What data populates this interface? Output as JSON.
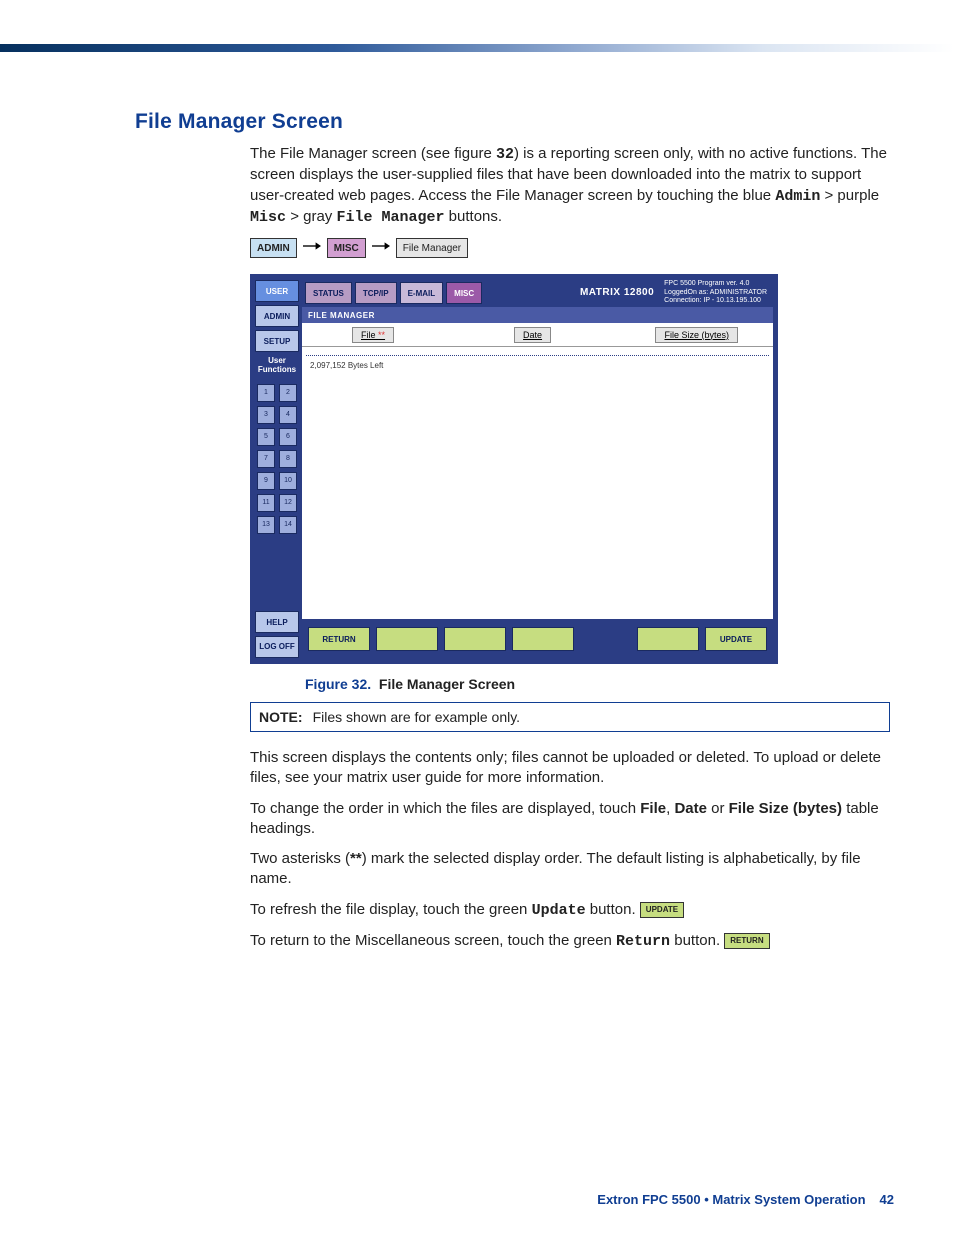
{
  "heading": "File Manager Screen",
  "p1": {
    "a": "The File Manager screen (see figure",
    "b": "32",
    "c": ") is a reporting screen only, with no active functions. The screen displays the user-supplied files that have been downloaded into the matrix to support user-created web pages. Access the File Manager screen by touching the blue",
    "d": "Admin",
    "e": "> purple",
    "f": "Misc",
    "g": "> gray",
    "h": "File Manager",
    "i": "buttons."
  },
  "breadcrumb": {
    "admin": "ADMIN",
    "misc": "MISC",
    "fm": "File Manager"
  },
  "screen": {
    "sidebar": {
      "user": "USER",
      "admin": "ADMIN",
      "setup": "SETUP",
      "userFunctions": "User\nFunctions",
      "help": "HELP",
      "logoff": "LOG\nOFF"
    },
    "keypad": [
      "1",
      "2",
      "3",
      "4",
      "5",
      "6",
      "7",
      "8",
      "9",
      "10",
      "11",
      "12",
      "13",
      "14"
    ],
    "tabs": {
      "status": "STATUS",
      "tcpip": "TCP/IP",
      "email": "E-MAIL",
      "misc": "MISC"
    },
    "header": {
      "matrix": "MATRIX 12800",
      "line1": "FPC 5500 Program  ver. 4.0",
      "line2": "LoggedOn as: ADMINISTRATOR",
      "line3": "Connection: IP - 10.13.195.100"
    },
    "fmTitle": "FILE MANAGER",
    "columns": {
      "file": "File",
      "mark": "**",
      "date": "Date",
      "size": "File Size  (bytes)"
    },
    "bytesLeft": "2,097,152 Bytes Left",
    "actions": {
      "return": "RETURN",
      "update": "UPDATE"
    }
  },
  "caption": {
    "num": "Figure 32.",
    "text": "File Manager Screen"
  },
  "note": {
    "label": "NOTE:",
    "text": "Files shown are for example only."
  },
  "p2": "This screen displays the contents only; files cannot be uploaded or deleted. To upload or delete files, see your matrix user guide for more information.",
  "p3": {
    "a": "To change the order in which the files are displayed, touch",
    "b": "File",
    "c": ",",
    "d": "Date",
    "e": "or",
    "f": "File Size (bytes)",
    "g": "table headings."
  },
  "p4": {
    "a": "Two asterisks (",
    "b": "**",
    "c": ") mark the selected display order. The default listing is alphabetically, by file name."
  },
  "p5": {
    "a": "To refresh the file display, touch the green",
    "b": "Update",
    "c": "button."
  },
  "p6": {
    "a": "To return to the Miscellaneous screen, touch the green",
    "b": "Return",
    "c": "button."
  },
  "inline": {
    "update": "UPDATE",
    "return": "RETURN"
  },
  "footer": {
    "text": "Extron FPC 5500 • Matrix System Operation",
    "page": "42"
  }
}
